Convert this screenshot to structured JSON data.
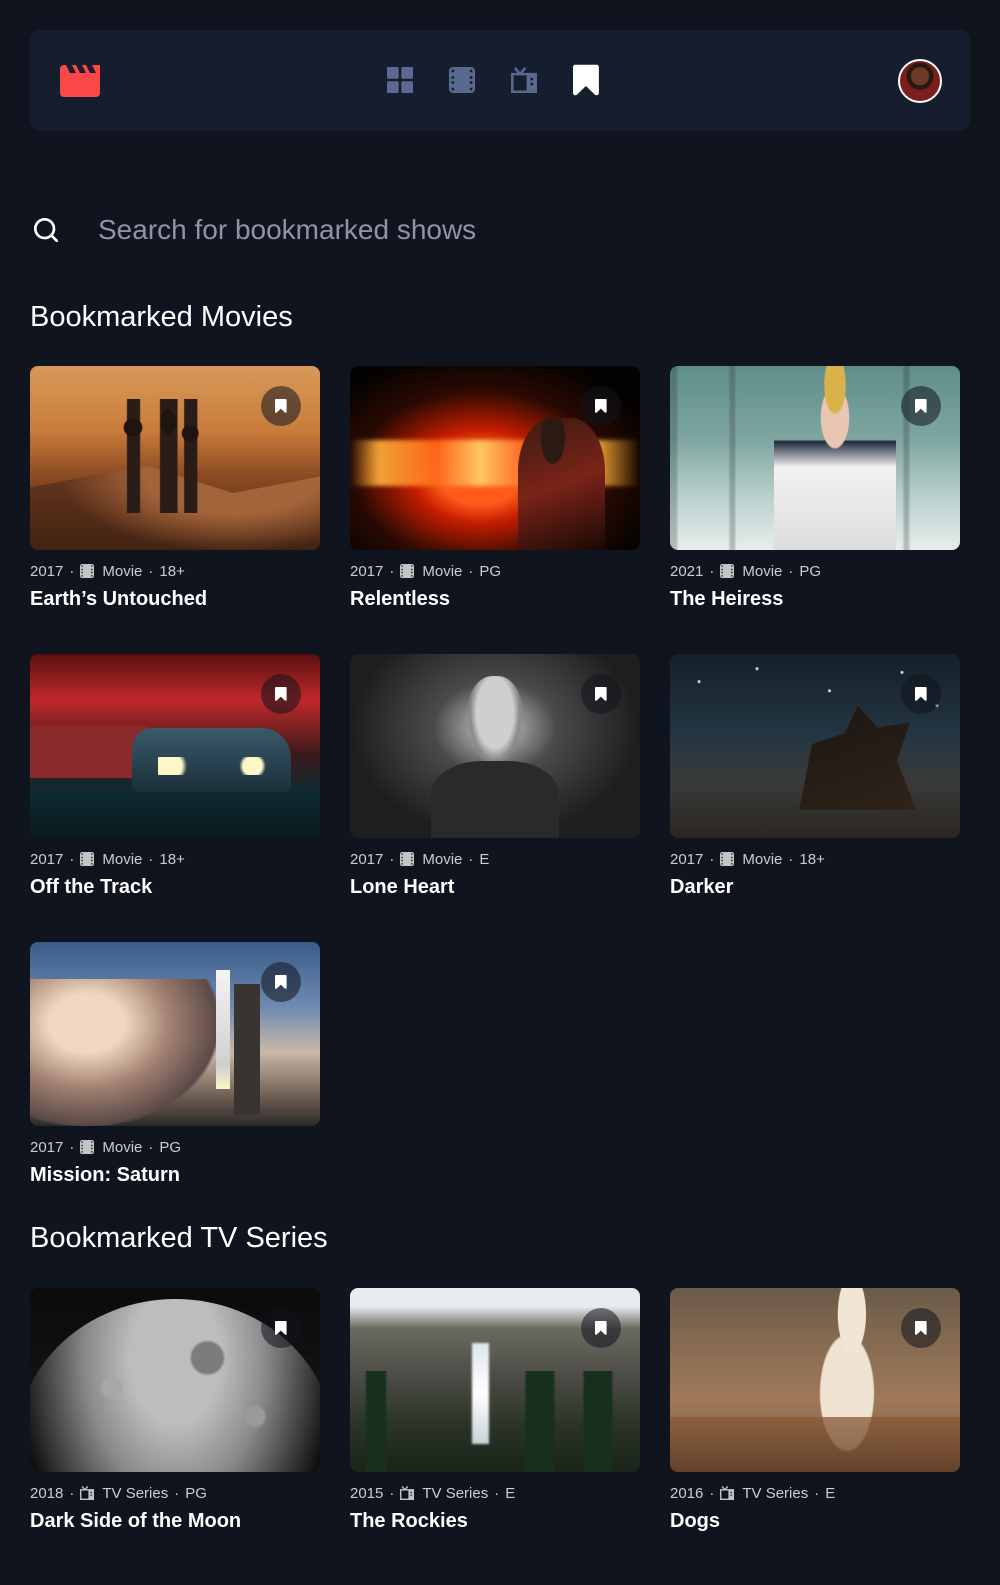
{
  "navbar": {
    "logo_icon": "movie-clapper-icon",
    "logo_color": "#fc4747",
    "nav_items": [
      {
        "icon": "home-grid-icon",
        "active": false
      },
      {
        "icon": "movies-film-icon",
        "active": false
      },
      {
        "icon": "tv-series-icon",
        "active": false
      },
      {
        "icon": "bookmark-icon",
        "active": true
      }
    ],
    "avatar_icon": "user-avatar"
  },
  "search": {
    "placeholder": "Search for bookmarked shows"
  },
  "sections": {
    "movies_title": "Bookmarked Movies",
    "tv_title": "Bookmarked TV Series"
  },
  "movies": [
    {
      "year": "2017",
      "category": "Movie",
      "rating": "18+",
      "title": "Earth’s Untouched"
    },
    {
      "year": "2017",
      "category": "Movie",
      "rating": "PG",
      "title": "Relentless"
    },
    {
      "year": "2021",
      "category": "Movie",
      "rating": "PG",
      "title": "The Heiress"
    },
    {
      "year": "2017",
      "category": "Movie",
      "rating": "18+",
      "title": "Off the Track"
    },
    {
      "year": "2017",
      "category": "Movie",
      "rating": "E",
      "title": "Lone Heart"
    },
    {
      "year": "2017",
      "category": "Movie",
      "rating": "18+",
      "title": "Darker"
    },
    {
      "year": "2017",
      "category": "Movie",
      "rating": "PG",
      "title": "Mission: Saturn"
    }
  ],
  "tv_series": [
    {
      "year": "2018",
      "category": "TV Series",
      "rating": "PG",
      "title": "Dark Side of the Moon"
    },
    {
      "year": "2015",
      "category": "TV Series",
      "rating": "E",
      "title": "The Rockies"
    },
    {
      "year": "2016",
      "category": "TV Series",
      "rating": "E",
      "title": "Dogs"
    }
  ],
  "colors": {
    "background": "#10141e",
    "surface": "#161d2f",
    "accent": "#fc4747",
    "nav_inactive": "#5a698f"
  }
}
